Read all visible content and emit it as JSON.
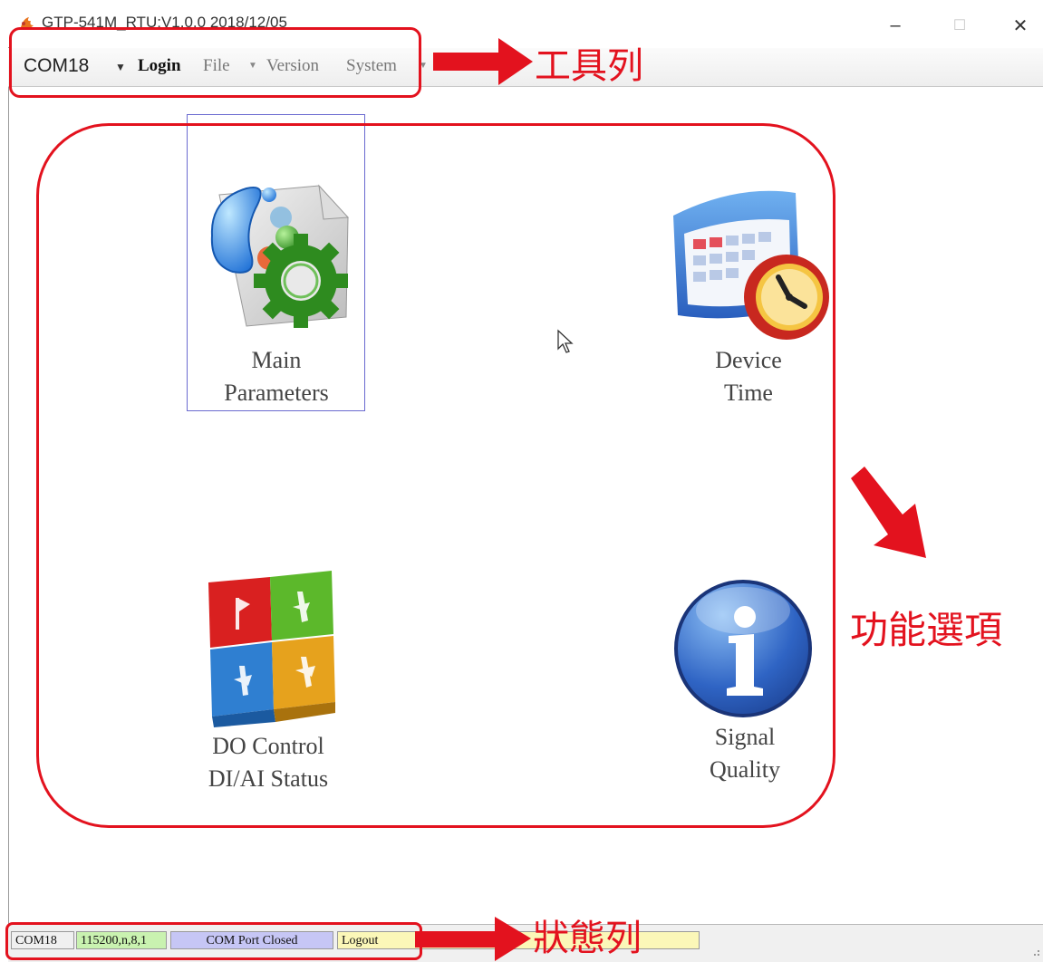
{
  "window": {
    "title": "GTP-541M_RTU:V1.0.0 2018/12/05",
    "minimize": "–",
    "maximize": "☐",
    "close": "✕"
  },
  "menu": {
    "port": "COM18",
    "login": "Login",
    "file": "File",
    "version": "Version",
    "system": "System"
  },
  "tiles": {
    "main_parameters": {
      "line1": "Main",
      "line2": "Parameters"
    },
    "device_time": {
      "line1": "Device",
      "line2": "Time"
    },
    "do_control": {
      "line1": "DO Control",
      "line2": "DI/AI Status"
    },
    "signal_quality": {
      "line1": "Signal",
      "line2": "Quality"
    }
  },
  "status": {
    "port": "COM18",
    "settings": "115200,n,8,1",
    "port_state": "COM Port Closed",
    "login_state": "Logout"
  },
  "annotations": {
    "toolbar": "工具列",
    "functions": "功能選項",
    "statusbar": "狀態列"
  },
  "colors": {
    "annotation": "#e3121e",
    "status_green": "#c9f2b0",
    "status_blue": "#c6c6f5",
    "status_yellow": "#fbf7b8"
  }
}
